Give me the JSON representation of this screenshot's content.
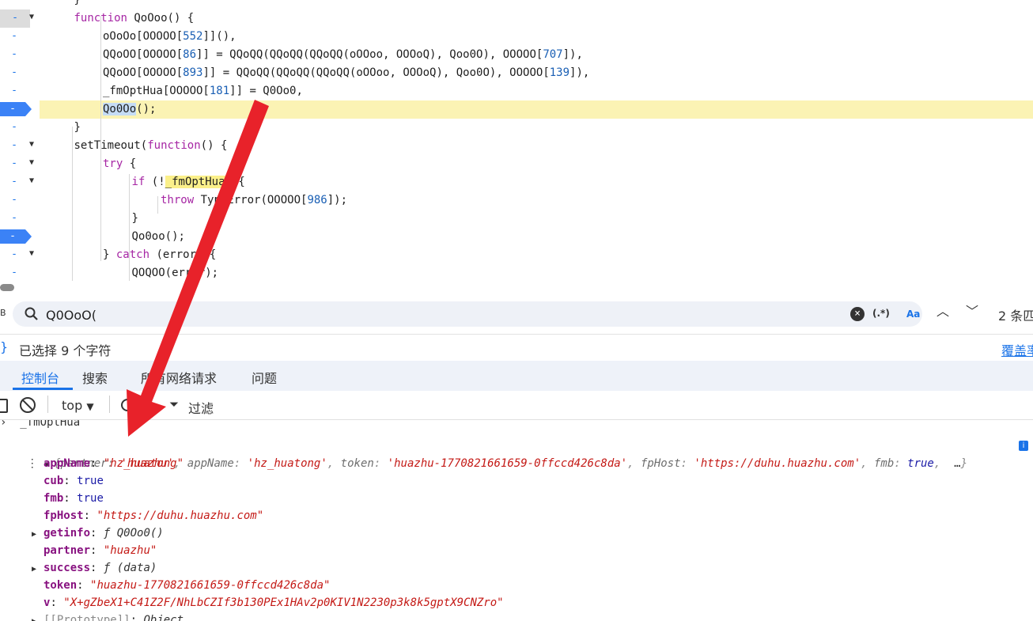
{
  "editor": {
    "lines": [
      {
        "id": "l0",
        "ln": "-",
        "fold": "",
        "indent": 3,
        "html_tokens": [
          {
            "t": "}"
          }
        ]
      },
      {
        "id": "l1",
        "ln": "-",
        "fold": "▼",
        "cur": true,
        "indent": 3,
        "html_tokens": [
          {
            "t": "function ",
            "c": "kw"
          },
          {
            "t": "QoOoo"
          },
          {
            "t": "() {"
          }
        ]
      },
      {
        "id": "l2",
        "ln": "-",
        "fold": "",
        "indent": 4,
        "html_tokens": [
          {
            "t": "oOoOo[OOOOO["
          },
          {
            "t": "552",
            "c": "num"
          },
          {
            "t": "]](),"
          }
        ]
      },
      {
        "id": "l3",
        "ln": "-",
        "fold": "",
        "indent": 4,
        "html_tokens": [
          {
            "t": "QQoOO[OOOOO["
          },
          {
            "t": "86",
            "c": "num"
          },
          {
            "t": "]] = QQoQQ(QQoQQ(QQoQQ(oOOoo, OOOoQ), Qoo0O), OOOOO["
          },
          {
            "t": "707",
            "c": "num"
          },
          {
            "t": "]),"
          }
        ]
      },
      {
        "id": "l4",
        "ln": "-",
        "fold": "",
        "indent": 4,
        "html_tokens": [
          {
            "t": "QQoOO[OOOOO["
          },
          {
            "t": "893",
            "c": "num"
          },
          {
            "t": "]] = QQoQQ(QQoQQ(QQoQQ(oOOoo, OOOoQ), Qoo0O), OOOOO["
          },
          {
            "t": "139",
            "c": "num"
          },
          {
            "t": "]),"
          }
        ]
      },
      {
        "id": "l5",
        "ln": "-",
        "fold": "",
        "indent": 4,
        "html_tokens": [
          {
            "t": "_fmOptHua[OOOOO["
          },
          {
            "t": "181",
            "c": "num"
          },
          {
            "t": "]] = Q0Oo0,"
          }
        ]
      },
      {
        "id": "l6",
        "ln": "-",
        "fold": "",
        "bp": true,
        "hl": true,
        "indent": 4,
        "html_tokens": [
          {
            "t": "Qo0Oo",
            "c": "sel"
          },
          {
            "t": "();"
          }
        ]
      },
      {
        "id": "l7",
        "ln": "-",
        "fold": "",
        "indent": 3,
        "html_tokens": [
          {
            "t": "}"
          }
        ]
      },
      {
        "id": "l8",
        "ln": "-",
        "fold": "▼",
        "indent": 3,
        "html_tokens": [
          {
            "t": "setTimeout("
          },
          {
            "t": "function",
            "c": "kw"
          },
          {
            "t": "() {"
          }
        ]
      },
      {
        "id": "l9",
        "ln": "-",
        "fold": "▼",
        "indent": 4,
        "html_tokens": [
          {
            "t": "try",
            "c": "kw"
          },
          {
            "t": " {"
          }
        ]
      },
      {
        "id": "l10",
        "ln": "-",
        "fold": "▼",
        "indent": 5,
        "html_tokens": [
          {
            "t": "if",
            "c": "kw"
          },
          {
            "t": " (!"
          },
          {
            "t": "_fmOptHua",
            "c": "yel"
          },
          {
            "t": ") {"
          }
        ]
      },
      {
        "id": "l11",
        "ln": "-",
        "fold": "",
        "indent": 6,
        "html_tokens": [
          {
            "t": "throw",
            "c": "kw"
          },
          {
            "t": " TypeError(OOOOO["
          },
          {
            "t": "986",
            "c": "num"
          },
          {
            "t": "]);"
          }
        ]
      },
      {
        "id": "l12",
        "ln": "-",
        "fold": "",
        "indent": 5,
        "html_tokens": [
          {
            "t": "}"
          }
        ]
      },
      {
        "id": "l13",
        "ln": "-",
        "fold": "",
        "bp": true,
        "indent": 5,
        "html_tokens": [
          {
            "t": "Qo0oo();"
          }
        ]
      },
      {
        "id": "l14",
        "ln": "-",
        "fold": "▼",
        "indent": 4,
        "html_tokens": [
          {
            "t": "} "
          },
          {
            "t": "catch",
            "c": "kw"
          },
          {
            "t": " (error) {"
          }
        ]
      },
      {
        "id": "l15",
        "ln": "-",
        "fold": "",
        "indent": 5,
        "html_tokens": [
          {
            "t": "QOQOO(error);"
          }
        ]
      }
    ]
  },
  "search": {
    "left_marker": "B",
    "query": "Q0OoO(",
    "regex_label": "(.*)",
    "case_label": "Aa",
    "count": "2 条匹"
  },
  "status": {
    "selection_text": "已选择 9 个字符",
    "coverage_link": "覆盖率"
  },
  "drawer_tabs": [
    {
      "label": "控制台",
      "active": true
    },
    {
      "label": "搜索"
    },
    {
      "label": "所有网络请求"
    },
    {
      "label": "问题"
    }
  ],
  "console_toolbar": {
    "context": "top",
    "context_caret": "▼",
    "filter_label": "过滤"
  },
  "console": {
    "prev_line": "_fmOptHua",
    "preview": {
      "partner": "'huazhu'",
      "appName": "'hz_huatong'",
      "token": "'huazhu-1770821661659-0ffccd426c8da'",
      "fpHost": "'https://duhu.huazhu.com'",
      "fmb": "true",
      "more": "…"
    },
    "info_badge": "i",
    "props": [
      {
        "key": "appName",
        "type": "str",
        "value": "\"hz_huatong\""
      },
      {
        "key": "cub",
        "type": "bool",
        "value": "true"
      },
      {
        "key": "fmb",
        "type": "bool",
        "value": "true"
      },
      {
        "key": "fpHost",
        "type": "str",
        "value": "\"https://duhu.huazhu.com\""
      },
      {
        "key": "getinfo",
        "type": "fn",
        "expand": true,
        "value": "ƒ Q0Oo0()"
      },
      {
        "key": "partner",
        "type": "str",
        "value": "\"huazhu\""
      },
      {
        "key": "success",
        "type": "fn",
        "expand": true,
        "value": "ƒ (data)"
      },
      {
        "key": "token",
        "type": "str",
        "value": "\"huazhu-1770821661659-0ffccd426c8da\""
      },
      {
        "key": "v",
        "type": "str",
        "value": "\"X+gZbeX1+C41Z2F/NhLbCZIf3b130PEx1HAv2p0KIV1N2230p3k8k5gptX9CNZro\""
      },
      {
        "key": "[[Prototype]]",
        "type": "proto",
        "expand": true,
        "value": "Object"
      }
    ]
  },
  "colors": {
    "accent": "#1a73e8",
    "highlight_line": "#fbf3b4",
    "arrow": "#e8222a"
  }
}
